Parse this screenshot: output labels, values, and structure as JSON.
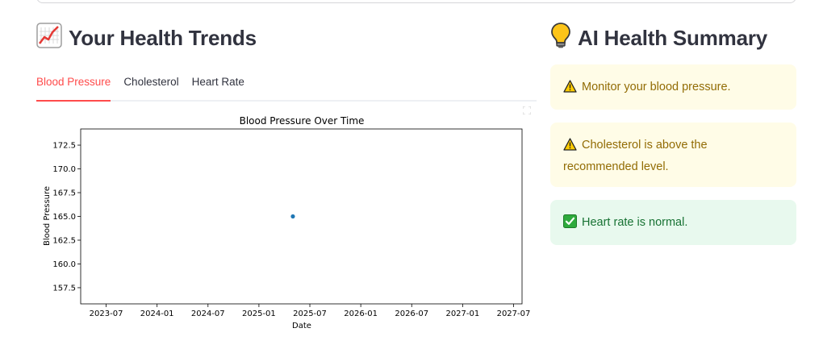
{
  "left": {
    "title": "Your Health Trends",
    "title_icon": "chart-increasing-icon",
    "tabs": [
      {
        "label": "Blood Pressure",
        "active": true
      },
      {
        "label": "Cholesterol",
        "active": false
      },
      {
        "label": "Heart Rate",
        "active": false
      }
    ]
  },
  "right": {
    "title": "AI Health Summary",
    "title_icon": "light-bulb-icon",
    "alerts": [
      {
        "type": "warning",
        "icon": "warning-icon",
        "text": "Monitor your blood pressure."
      },
      {
        "type": "warning",
        "icon": "warning-icon",
        "text": "Cholesterol is above the recommended level."
      },
      {
        "type": "success",
        "icon": "check-mark-icon",
        "text": "Heart rate is normal."
      }
    ]
  },
  "colors": {
    "accent": "#ff4b4b",
    "warning_bg": "#fffce7",
    "warning_text": "#926c05",
    "success_bg": "#e8f9ee",
    "success_text": "#177233",
    "point": "#1f77b4"
  },
  "chart_data": {
    "type": "scatter",
    "title": "Blood Pressure Over Time",
    "xlabel": "Date",
    "ylabel": "Blood Pressure",
    "x_tick_labels": [
      "2023-07",
      "2024-01",
      "2024-07",
      "2025-01",
      "2025-07",
      "2026-01",
      "2026-07",
      "2027-01",
      "2027-07"
    ],
    "y_ticks": [
      157.5,
      160.0,
      162.5,
      165.0,
      167.5,
      170.0,
      172.5
    ],
    "y_tick_labels": [
      "157.5",
      "160.0",
      "162.5",
      "165.0",
      "167.5",
      "170.0",
      "172.5"
    ],
    "xlim": [
      "2023-04",
      "2027-08"
    ],
    "ylim": [
      155.8,
      174.2
    ],
    "points": [
      {
        "x": "2025-05",
        "y": 165.0
      }
    ],
    "grid": false
  }
}
